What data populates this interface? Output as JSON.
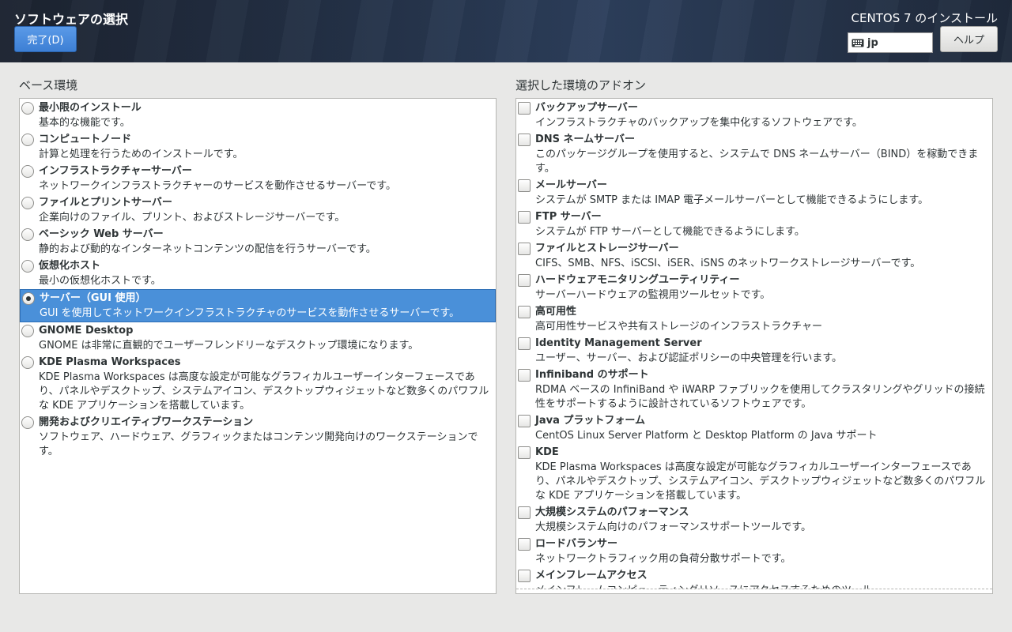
{
  "header": {
    "page_title": "ソフトウェアの選択",
    "done_label": "完了(D)",
    "install_title": "CENTOS 7 のインストール",
    "keyboard_layout": "jp",
    "keyboard_icon": "keyboard-icon",
    "help_label": "ヘルプ"
  },
  "base_env": {
    "heading": "ベース環境",
    "selected_index": 6,
    "items": [
      {
        "name": "最小限のインストール",
        "desc": "基本的な機能です。"
      },
      {
        "name": "コンピュートノード",
        "desc": "計算と処理を行うためのインストールです。"
      },
      {
        "name": "インフラストラクチャーサーバー",
        "desc": "ネットワークインフラストラクチャーのサービスを動作させるサーバーです。"
      },
      {
        "name": "ファイルとプリントサーバー",
        "desc": "企業向けのファイル、プリント、およびストレージサーバーです。"
      },
      {
        "name": "ベーシック Web サーバー",
        "desc": "静的および動的なインターネットコンテンツの配信を行うサーバーです。"
      },
      {
        "name": "仮想化ホスト",
        "desc": "最小の仮想化ホストです。"
      },
      {
        "name": "サーバー（GUI 使用）",
        "desc": "GUI を使用してネットワークインフラストラクチャのサービスを動作させるサーバーです。"
      },
      {
        "name": "GNOME Desktop",
        "desc": "GNOME は非常に直観的でユーザーフレンドリーなデスクトップ環境になります。"
      },
      {
        "name": "KDE Plasma Workspaces",
        "desc": "KDE Plasma Workspaces は高度な設定が可能なグラフィカルユーザーインターフェースであり、パネルやデスクトップ、システムアイコン、デスクトップウィジェットなど数多くのパワフルな KDE アプリケーションを搭載しています。"
      },
      {
        "name": "開発およびクリエイティブワークステーション",
        "desc": "ソフトウェア、ハードウェア、グラフィックまたはコンテンツ開発向けのワークステーションです。"
      }
    ]
  },
  "addons": {
    "heading": "選択した環境のアドオン",
    "items": [
      {
        "name": "バックアップサーバー",
        "desc": "インフラストラクチャのバックアップを集中化するソフトウェアです。",
        "checked": false
      },
      {
        "name": "DNS ネームサーバー",
        "desc": "このパッケージグループを使用すると、システムで DNS ネームサーバー（BIND）を稼動できます。",
        "checked": false
      },
      {
        "name": "メールサーバー",
        "desc": "システムが SMTP または IMAP 電子メールサーバーとして機能できるようにします。",
        "checked": false
      },
      {
        "name": "FTP サーバー",
        "desc": "システムが FTP サーバーとして機能できるようにします。",
        "checked": false
      },
      {
        "name": "ファイルとストレージサーバー",
        "desc": "CIFS、SMB、NFS、iSCSI、iSER、iSNS のネットワークストレージサーバーです。",
        "checked": false
      },
      {
        "name": "ハードウェアモニタリングユーティリティー",
        "desc": "サーバーハードウェアの監視用ツールセットです。",
        "checked": false
      },
      {
        "name": "高可用性",
        "desc": "高可用性サービスや共有ストレージのインフラストラクチャー",
        "checked": false
      },
      {
        "name": "Identity Management Server",
        "desc": "ユーザー、サーバー、および認証ポリシーの中央管理を行います。",
        "checked": false
      },
      {
        "name": "Infiniband のサポート",
        "desc": "RDMA ベースの InfiniBand や iWARP ファブリックを使用してクラスタリングやグリッドの接続性をサポートするように設計されているソフトウェアです。",
        "checked": false
      },
      {
        "name": "Java プラットフォーム",
        "desc": "CentOS Linux Server Platform と Desktop Platform の Java サポート",
        "checked": false
      },
      {
        "name": "KDE",
        "desc": "KDE Plasma Workspaces は高度な設定が可能なグラフィカルユーザーインターフェースであり、パネルやデスクトップ、システムアイコン、デスクトップウィジェットなど数多くのパワフルな KDE アプリケーションを搭載しています。",
        "checked": false
      },
      {
        "name": "大規模システムのパフォーマンス",
        "desc": "大規模システム向けのパフォーマンスサポートツールです。",
        "checked": false
      },
      {
        "name": "ロードバランサー",
        "desc": "ネットワークトラフィック用の負荷分散サポートです。",
        "checked": false
      },
      {
        "name": "メインフレームアクセス",
        "desc": "メインフレームコンピューティングリソースにアクセスするためのツール",
        "checked": false
      }
    ]
  }
}
